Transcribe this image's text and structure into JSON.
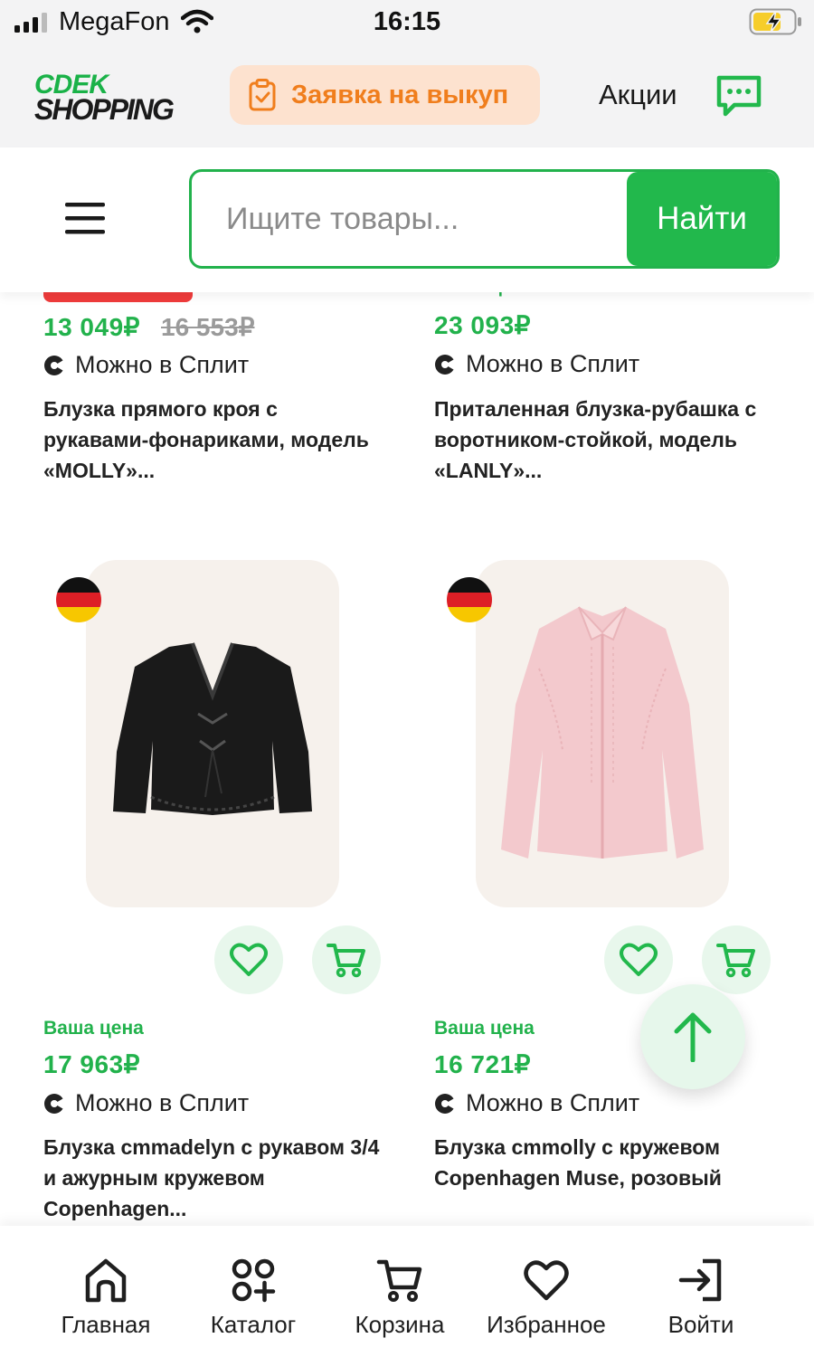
{
  "status_bar": {
    "carrier": "MegaFon",
    "time": "16:15"
  },
  "header": {
    "logo_line1": "CDEK",
    "logo_line2": "SHOPPING",
    "buyout_request": "Заявка на выкуп",
    "promos": "Акции"
  },
  "search": {
    "placeholder": "Ищите товары...",
    "button_label": "Найти"
  },
  "colors": {
    "brand_green": "#22b84c",
    "accent_orange": "#f07e1d",
    "sale_red": "#ef3b3b"
  },
  "products": [
    {
      "price": "13 049₽",
      "old_price": "16 553₽",
      "split_label": "Можно в Сплит",
      "title": "Блузка прямого кроя с рукавами-фонариками, модель «MOLLY»..."
    },
    {
      "price_label": "Ваша цена",
      "price": "23 093₽",
      "split_label": "Можно в Сплит",
      "title": "Приталенная блузка-рубашка с воротником-стойкой, модель «LANLY»..."
    },
    {
      "flag": "germany-flag-icon",
      "price_label": "Ваша цена",
      "price": "17 963₽",
      "split_label": "Можно в Сплит",
      "title": "Блузка cmmadelyn с рукавом 3/4 и ажурным кружевом Copenhagen..."
    },
    {
      "flag": "germany-flag-icon",
      "price_label": "Ваша цена",
      "price": "16 721₽",
      "split_label": "Можно в Сплит",
      "title": "Блузка cmmolly с кружевом Copenhagen Muse, розовый"
    }
  ],
  "bottom_nav": [
    {
      "label": "Главная",
      "icon": "home-icon"
    },
    {
      "label": "Каталог",
      "icon": "catalog-icon"
    },
    {
      "label": "Корзина",
      "icon": "cart-icon"
    },
    {
      "label": "Избранное",
      "icon": "heart-icon"
    },
    {
      "label": "Войти",
      "icon": "login-icon"
    }
  ]
}
